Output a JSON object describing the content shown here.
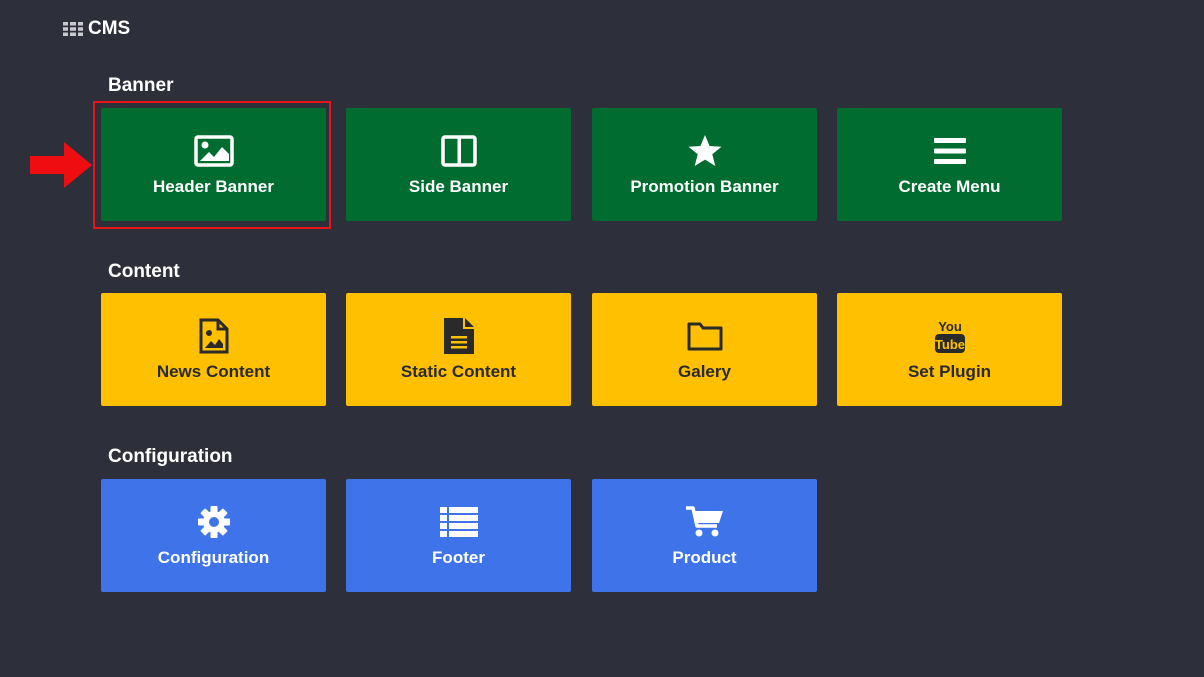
{
  "app": {
    "title": "CMS",
    "icon": "grid-icon"
  },
  "colors": {
    "background": "#2d2f3b",
    "banner_tile": "#006c30",
    "content_tile": "#fec000",
    "configuration_tile": "#3f73ea",
    "highlight": "#e8141c"
  },
  "sections": {
    "banner": {
      "title": "Banner",
      "tiles": [
        {
          "label": "Header Banner",
          "icon": "image-icon",
          "highlighted": true
        },
        {
          "label": "Side Banner",
          "icon": "columns-icon"
        },
        {
          "label": "Promotion Banner",
          "icon": "star-icon"
        },
        {
          "label": "Create Menu",
          "icon": "menu-icon"
        }
      ]
    },
    "content": {
      "title": "Content",
      "tiles": [
        {
          "label": "News Content",
          "icon": "file-image-icon"
        },
        {
          "label": "Static Content",
          "icon": "file-text-icon"
        },
        {
          "label": "Galery",
          "icon": "folder-icon"
        },
        {
          "label": "Set Plugin",
          "icon": "youtube-icon"
        }
      ]
    },
    "configuration": {
      "title": "Configuration",
      "tiles": [
        {
          "label": "Configuration",
          "icon": "gear-icon"
        },
        {
          "label": "Footer",
          "icon": "list-icon"
        },
        {
          "label": "Product",
          "icon": "cart-icon"
        }
      ]
    }
  }
}
